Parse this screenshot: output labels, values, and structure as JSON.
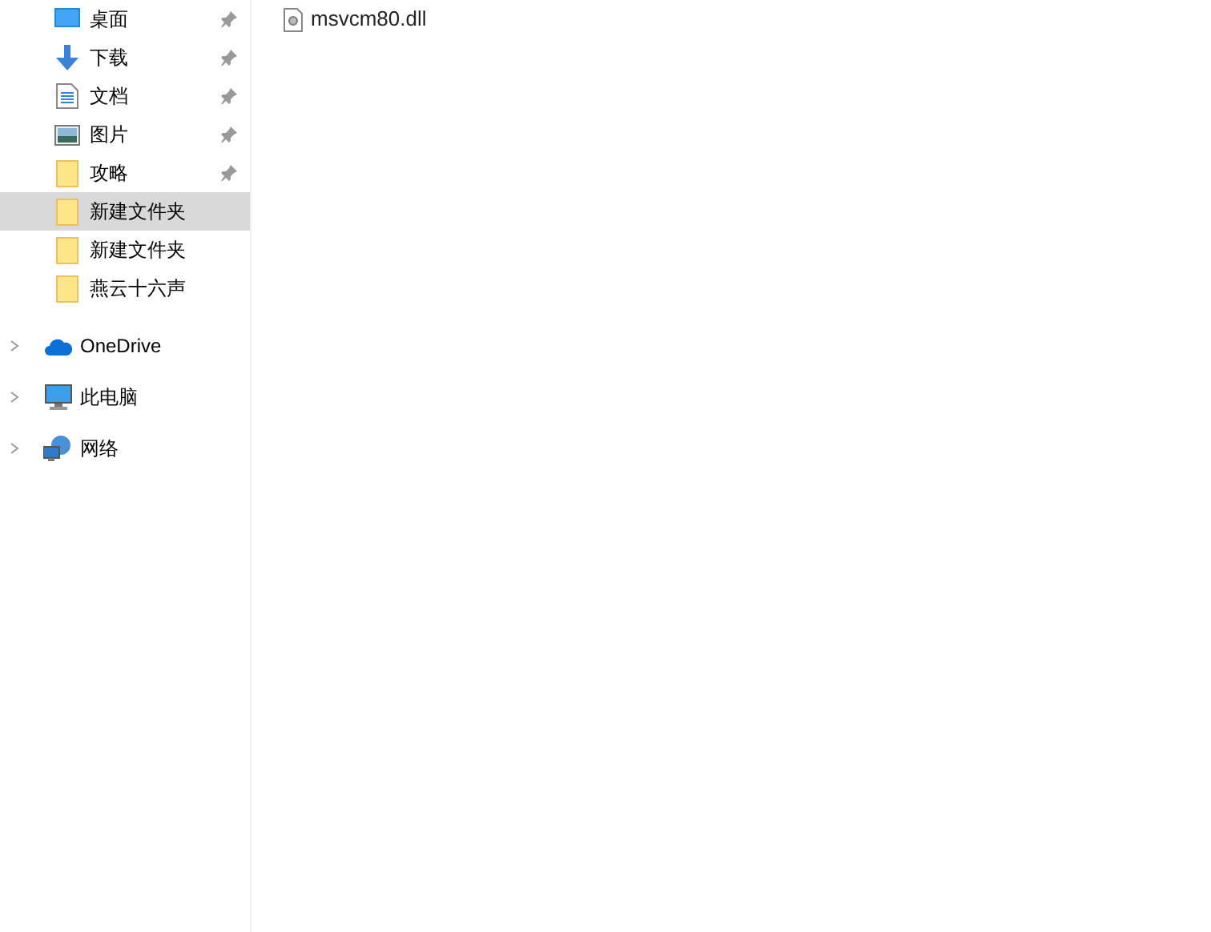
{
  "quick_access": [
    {
      "label": "桌面",
      "kind": "desktop",
      "pinned": true,
      "selected": false
    },
    {
      "label": "下载",
      "kind": "download",
      "pinned": true,
      "selected": false
    },
    {
      "label": "文档",
      "kind": "document",
      "pinned": true,
      "selected": false
    },
    {
      "label": "图片",
      "kind": "picture",
      "pinned": true,
      "selected": false
    },
    {
      "label": "攻略",
      "kind": "folder",
      "pinned": true,
      "selected": false
    },
    {
      "label": "新建文件夹",
      "kind": "folder",
      "pinned": false,
      "selected": true
    },
    {
      "label": "新建文件夹",
      "kind": "folder",
      "pinned": false,
      "selected": false
    },
    {
      "label": "燕云十六声",
      "kind": "folder",
      "pinned": false,
      "selected": false
    }
  ],
  "locations": [
    {
      "label": "OneDrive",
      "kind": "cloud",
      "expanded": false
    },
    {
      "label": "此电脑",
      "kind": "computer",
      "expanded": false
    },
    {
      "label": "网络",
      "kind": "network",
      "expanded": false
    }
  ],
  "files": [
    {
      "name": "msvcm80.dll"
    }
  ]
}
